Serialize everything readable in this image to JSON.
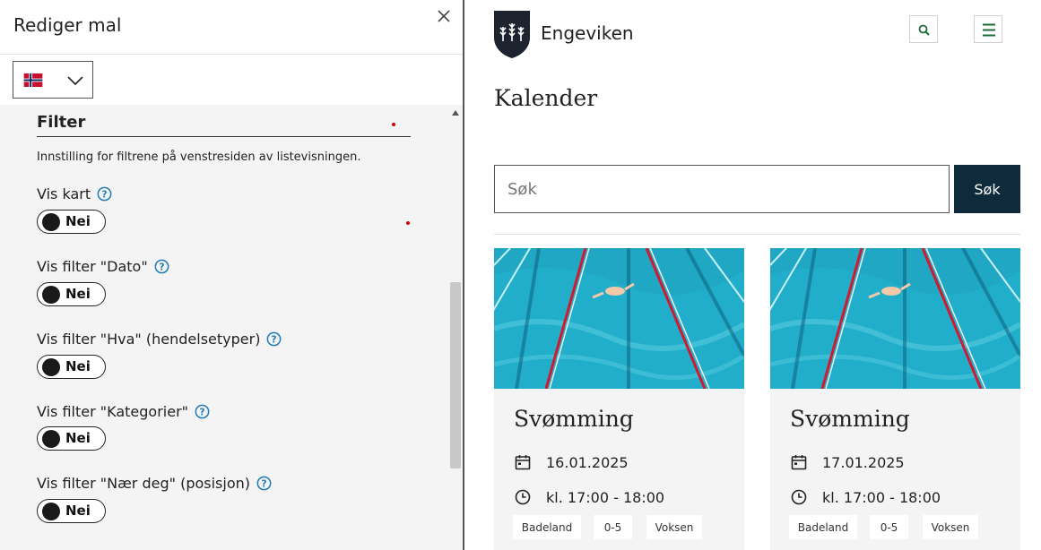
{
  "editor": {
    "title": "Rediger mal",
    "language": "norwegian-flag-icon",
    "filter": {
      "heading": "Filter",
      "description": "Innstilling for filtrene på venstresiden av listevisningen."
    },
    "options": [
      {
        "label": "Vis kart",
        "toggle": "Nei"
      },
      {
        "label": "Vis filter \"Dato\"",
        "toggle": "Nei"
      },
      {
        "label": "Vis filter \"Hva\" (hendelsetyper)",
        "toggle": "Nei"
      },
      {
        "label": "Vis filter \"Kategorier\"",
        "toggle": "Nei"
      },
      {
        "label": "Vis filter \"Nær deg\" (posisjon)",
        "toggle": "Nei"
      }
    ]
  },
  "preview": {
    "brand": "Engeviken",
    "page_title": "Kalender",
    "search": {
      "placeholder": "Søk",
      "button": "Søk"
    },
    "events": [
      {
        "title": "Svømming",
        "date": "16.01.2025",
        "time": "kl. 17:00 - 18:00",
        "tags": [
          "Badeland",
          "0-5",
          "Voksen"
        ]
      },
      {
        "title": "Svømming",
        "date": "17.01.2025",
        "time": "kl. 17:00 - 18:00",
        "tags": [
          "Badeland",
          "0-5",
          "Voksen"
        ]
      }
    ]
  },
  "colors": {
    "accent_dark": "#0e2a3b",
    "help_icon": "#1f7ab8",
    "menu_icon": "#1d6b3a",
    "editor_bg": "#f4f4f4"
  }
}
